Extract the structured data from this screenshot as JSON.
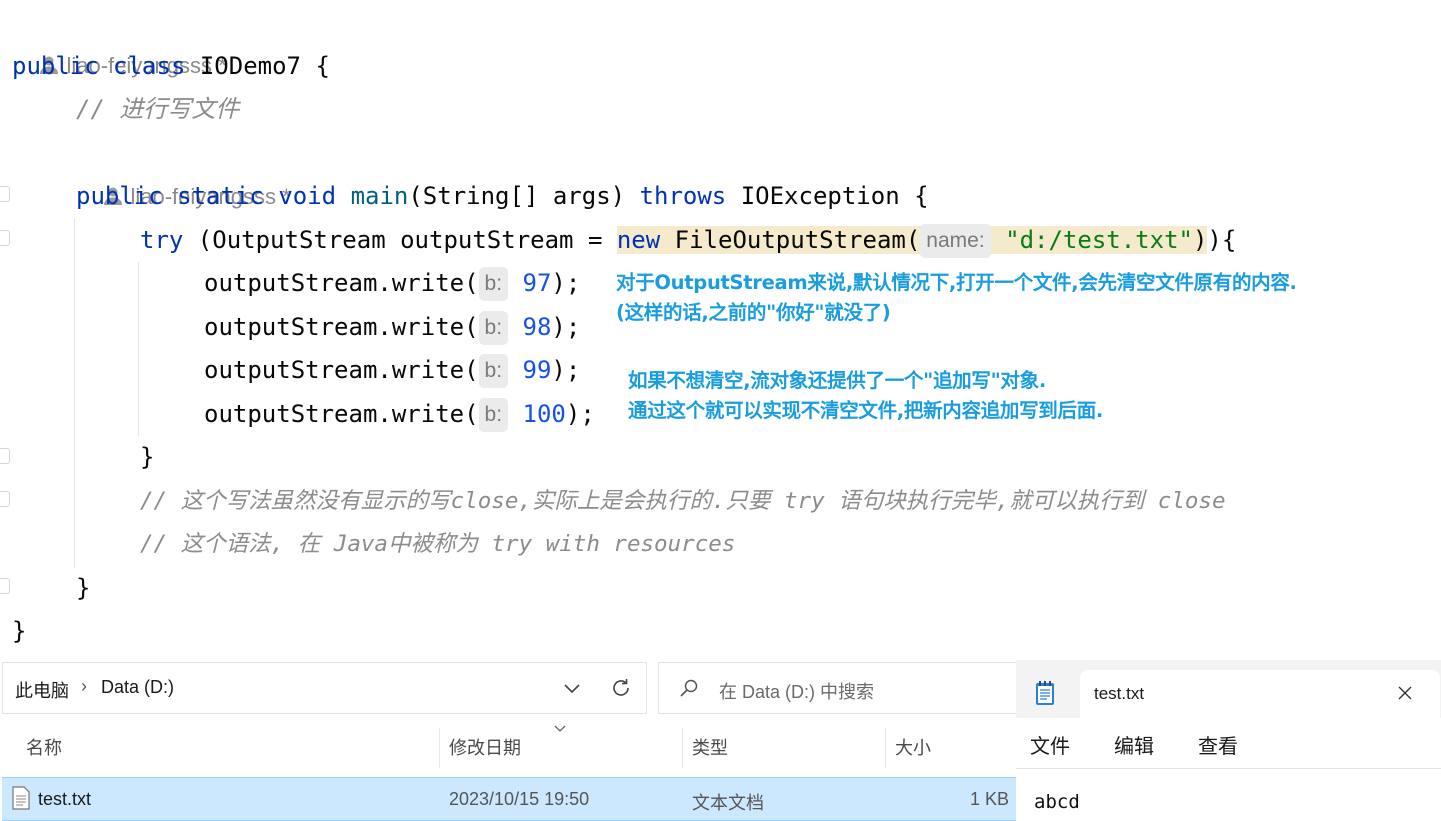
{
  "editor": {
    "author_top": "liao-feiyangsss *",
    "author_main": "liao-feiyangsss *",
    "line_class": {
      "kw1": "public",
      "kw2": "class",
      "name": "IODemo7",
      "brace": "{"
    },
    "comment_write": "// 进行写文件",
    "line_main": {
      "kw1": "public",
      "kw2": "static",
      "kw3": "void",
      "fn": "main",
      "params": "(String[] args) ",
      "kw4": "throws",
      "rest": " IOException {"
    },
    "line_try": {
      "kw": "try",
      "mid": " (OutputStream outputStream = ",
      "kw_new": "new",
      "ctor": " FileOutputStream(",
      "hint": "name:",
      "str": "\"d:/test.txt\"",
      "end": ")){"
    },
    "writes": [
      {
        "call": "outputStream.write(",
        "hint": "b:",
        "value": "97",
        "end": ");"
      },
      {
        "call": "outputStream.write(",
        "hint": "b:",
        "value": "98",
        "end": ");"
      },
      {
        "call": "outputStream.write(",
        "hint": "b:",
        "value": "99",
        "end": ");"
      },
      {
        "call": "outputStream.write(",
        "hint": "b:",
        "value": "100",
        "end": ");"
      }
    ],
    "close_try": "}",
    "comment_close": "// 这个写法虽然没有显示的写close,实际上是会执行的.只要 try 语句块执行完毕,就可以执行到 close",
    "comment_resources": "// 这个语法, 在 Java中被称为 try with resources",
    "close_main": "}",
    "close_class": "}"
  },
  "annotations": {
    "note1_line1": "对于OutputStream来说,默认情况下,打开一个文件,会先清空文件原有的内容.",
    "note1_line2": "(这样的话,之前的\"你好\"就没了)",
    "note2_line1": "如果不想清空,流对象还提供了一个\"追加写\"对象.",
    "note2_line2": "通过这个就可以实现不清空文件,把新内容追加写到后面."
  },
  "explorer": {
    "breadcrumb_root": "此电脑",
    "breadcrumb_drive": "Data (D:)",
    "search_placeholder": "在 Data (D:) 中搜索",
    "columns": [
      "名称",
      "修改日期",
      "类型",
      "大小"
    ],
    "file": {
      "name": "test.txt",
      "modified": "2023/10/15 19:50",
      "type": "文本文档",
      "size": "1 KB"
    }
  },
  "notepad": {
    "tab_title": "test.txt",
    "menu": [
      "文件",
      "编辑",
      "查看"
    ],
    "content": "abcd"
  },
  "colors": {
    "keyword": "#0033b3",
    "string": "#067d17",
    "number": "#1750eb",
    "comment": "#8c8c8c",
    "annotation": "#1a9ddf",
    "selection": "#cce8ff"
  }
}
